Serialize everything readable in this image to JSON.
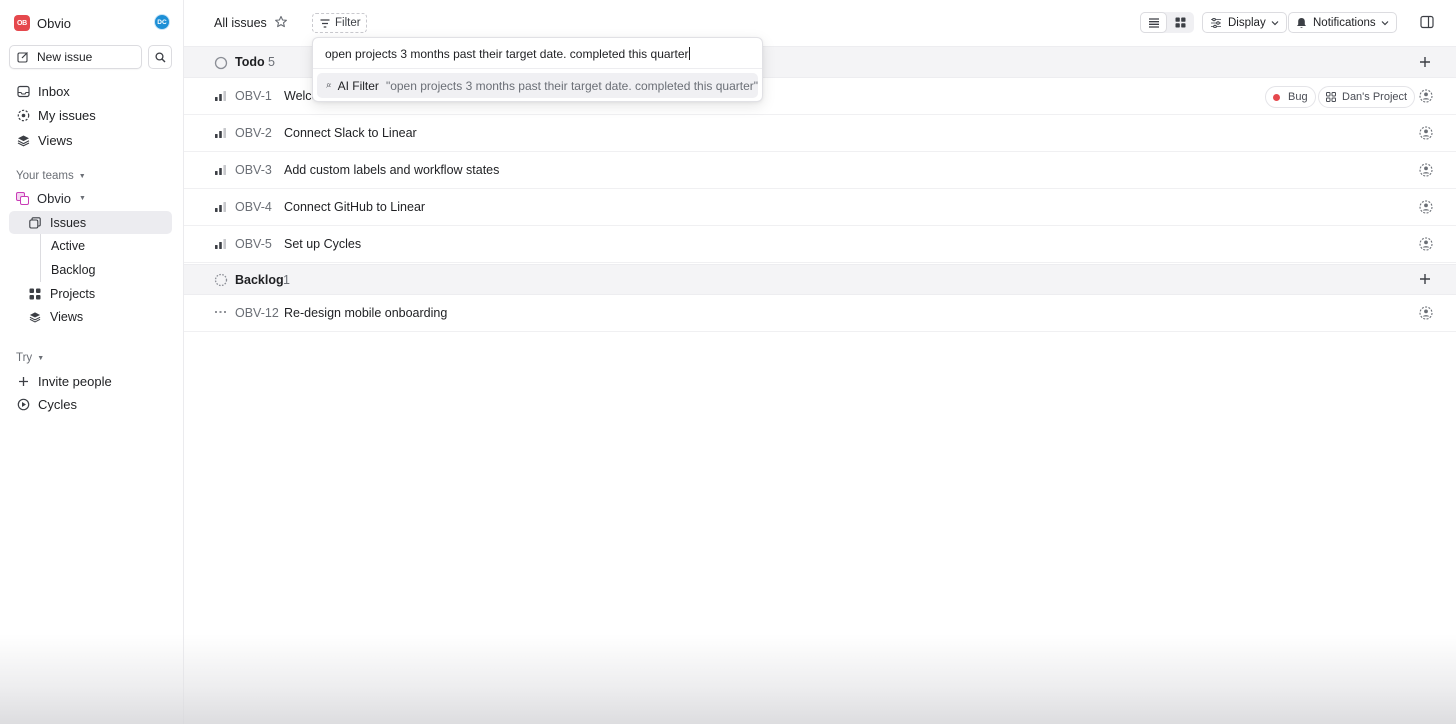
{
  "colors": {
    "accent": "#5e6ad2",
    "bug": "#e5484d",
    "workspace": "#e5484d",
    "avatar": "#1d8fd6"
  },
  "sidebar": {
    "workspace_initials": "OB",
    "workspace_name": "Obvio",
    "user_initials": "DC",
    "new_issue_label": "New issue",
    "nav": [
      {
        "label": "Inbox",
        "icon": "inbox-icon"
      },
      {
        "label": "My issues",
        "icon": "my-issues-icon"
      },
      {
        "label": "Views",
        "icon": "layers-icon"
      }
    ],
    "teams_label": "Your teams",
    "team_name": "Obvio",
    "team_items": [
      {
        "label": "Issues",
        "icon": "issues-icon"
      },
      {
        "label": "Active"
      },
      {
        "label": "Backlog"
      },
      {
        "label": "Projects",
        "icon": "projects-icon"
      },
      {
        "label": "Views",
        "icon": "layers-icon"
      }
    ],
    "try_label": "Try",
    "try_items": [
      {
        "label": "Invite people",
        "icon": "plus-icon"
      },
      {
        "label": "Cycles",
        "icon": "cycles-icon"
      }
    ]
  },
  "header": {
    "title": "All issues",
    "filter_label": "Filter",
    "display_label": "Display",
    "notifications_label": "Notifications"
  },
  "filter_dropdown": {
    "input_value": "open projects 3 months past their target date. completed this quarter",
    "option_label": "AI Filter",
    "option_query": "\"open projects 3 months past their target date. completed this quarter\""
  },
  "groups": [
    {
      "name": "Todo",
      "count": "5",
      "issues": [
        {
          "id": "OBV-1",
          "title": "Welco",
          "labels": [
            "Bug"
          ],
          "project": "Dan's Project"
        },
        {
          "id": "OBV-2",
          "title": "Connect Slack to Linear"
        },
        {
          "id": "OBV-3",
          "title": "Add custom labels and workflow states"
        },
        {
          "id": "OBV-4",
          "title": "Connect GitHub to Linear"
        },
        {
          "id": "OBV-5",
          "title": "Set up Cycles"
        }
      ]
    },
    {
      "name": "Backlog",
      "count": "1",
      "issues": [
        {
          "id": "OBV-12",
          "title": "Re-design mobile onboarding"
        }
      ]
    }
  ]
}
